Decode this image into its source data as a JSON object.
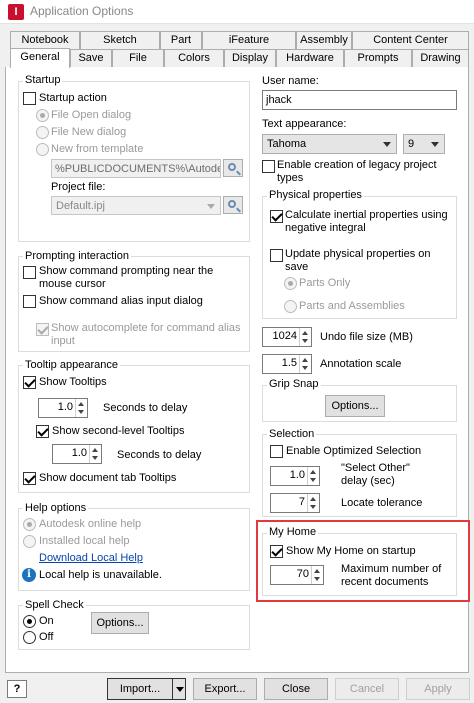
{
  "window": {
    "title": "Application Options",
    "icon": "autodesk-inventor-icon",
    "icon_letter": "I"
  },
  "tabs_row1": [
    {
      "label": "Notebook"
    },
    {
      "label": "Sketch"
    },
    {
      "label": "Part"
    },
    {
      "label": "iFeature"
    },
    {
      "label": "Assembly"
    },
    {
      "label": "Content Center"
    }
  ],
  "tabs_row2": [
    {
      "label": "General",
      "active": true
    },
    {
      "label": "Save"
    },
    {
      "label": "File"
    },
    {
      "label": "Colors"
    },
    {
      "label": "Display"
    },
    {
      "label": "Hardware"
    },
    {
      "label": "Prompts"
    },
    {
      "label": "Drawing"
    }
  ],
  "startup": {
    "title": "Startup",
    "startup_action": {
      "label": "Startup action",
      "checked": false
    },
    "file_open_dialog": "File Open dialog",
    "file_new_dialog": "File New dialog",
    "new_from_template": "New from template",
    "template_path": "%PUBLICDOCUMENTS%\\Autodes",
    "project_file_label": "Project file:",
    "project_file_value": "Default.ipj"
  },
  "prompting": {
    "title": "Prompting interaction",
    "show_command_prompting": {
      "label": "Show command prompting near the mouse cursor",
      "checked": false
    },
    "show_alias_dialog": {
      "label": "Show command alias input dialog",
      "checked": false
    },
    "show_autocomplete": {
      "label": "Show autocomplete for command alias input",
      "checked": true
    }
  },
  "tooltip": {
    "title": "Tooltip appearance",
    "show_tooltips": {
      "label": "Show Tooltips",
      "checked": true
    },
    "delay1_value": "1.0",
    "delay1_label": "Seconds to delay",
    "show_second_level": {
      "label": "Show second-level Tooltips",
      "checked": true
    },
    "delay2_value": "1.0",
    "delay2_label": "Seconds to delay",
    "show_document_tab": {
      "label": "Show document tab Tooltips",
      "checked": true
    }
  },
  "help_options": {
    "title": "Help options",
    "online": "Autodesk online help",
    "local": "Installed local help",
    "download_link": "Download Local Help",
    "info_text": "Local help is unavailable.",
    "info_letter": "i"
  },
  "spell_check": {
    "title": "Spell Check",
    "on": "On",
    "off": "Off",
    "options_button": "Options..."
  },
  "user": {
    "label": "User name:",
    "value": "jhack",
    "text_appearance_label": "Text appearance:",
    "font": "Tahoma",
    "size": "9",
    "legacy_projects": {
      "label": "Enable creation of legacy project types",
      "checked": false
    }
  },
  "physical": {
    "title": "Physical properties",
    "calc_inertial": {
      "label": "Calculate inertial properties using negative integral",
      "checked": true
    },
    "update_on_save": {
      "label": "Update physical properties on save",
      "checked": false
    },
    "parts_only": "Parts Only",
    "parts_and_assemblies": "Parts and Assemblies"
  },
  "undo": {
    "value": "1024",
    "label": "Undo file size (MB)"
  },
  "annotation": {
    "value": "1.5",
    "label": "Annotation scale"
  },
  "grip_snap": {
    "title": "Grip Snap",
    "options_button": "Options..."
  },
  "selection": {
    "title": "Selection",
    "optimized": {
      "label": "Enable Optimized Selection",
      "checked": false
    },
    "select_other_value": "1.0",
    "select_other_label": "\"Select Other\" delay (sec)",
    "locate_value": "7",
    "locate_label": "Locate tolerance"
  },
  "my_home": {
    "title": "My Home",
    "show_on_startup": {
      "label": "Show My Home on startup",
      "checked": true
    },
    "max_docs_value": "70",
    "max_docs_label": "Maximum number of recent documents",
    "highlight_color": "#e0393e"
  },
  "footer": {
    "help_symbol": "?",
    "import": "Import...",
    "export": "Export...",
    "close": "Close",
    "cancel": "Cancel",
    "apply": "Apply"
  }
}
